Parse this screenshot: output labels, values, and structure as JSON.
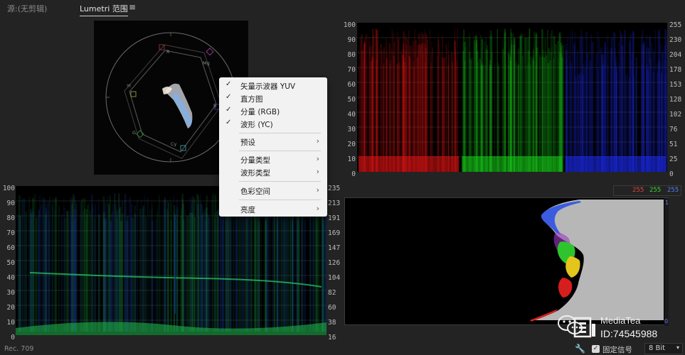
{
  "tabs": {
    "source": "源:(无剪辑)",
    "active": "Lumetri 范围",
    "menu_icon": "hamburger-menu-icon"
  },
  "vectorscope": {
    "targets": [
      "R",
      "Mg",
      "B",
      "Cy",
      "G",
      "Yl"
    ]
  },
  "parade": {
    "left_scale": [
      "100",
      "90",
      "80",
      "70",
      "60",
      "50",
      "40",
      "30",
      "20",
      "10",
      "0"
    ],
    "right_scale": [
      "255",
      "230",
      "204",
      "178",
      "153",
      "128",
      "102",
      "76",
      "51",
      "25",
      "0"
    ],
    "colors": {
      "red": "#e01414",
      "green": "#18d21a",
      "blue": "#1d2cf0"
    }
  },
  "waveform": {
    "left_scale": [
      "100",
      "90",
      "80",
      "70",
      "60",
      "50",
      "40",
      "30",
      "20",
      "10",
      "0"
    ],
    "right_scale": [
      "235",
      "213",
      "191",
      "169",
      "147",
      "126",
      "104",
      "82",
      "60",
      "38",
      "16"
    ],
    "colors": {
      "main": "#1a9c3c",
      "mix": "#1e40c8"
    }
  },
  "histogram": {
    "readout_r": "255",
    "readout_g": "255",
    "readout_b": "255",
    "scale_top": "1",
    "scale_bottom": "0",
    "colors": {
      "gray": "#b7b7b7",
      "blue": "#3b5be0",
      "green": "#2ec42e",
      "yellow": "#e3c51c",
      "red": "#d61e1e",
      "purple": "#9c3cc4"
    }
  },
  "context_menu": {
    "items": [
      {
        "label": "矢量示波器 YUV",
        "checked": true
      },
      {
        "label": "直方图",
        "checked": true
      },
      {
        "label": "分量 (RGB)",
        "checked": true
      },
      {
        "label": "波形 (YC)",
        "checked": true
      },
      {
        "label": "预设"
      },
      {
        "label": "分量类型"
      },
      {
        "label": "波形类型"
      },
      {
        "label": "色彩空间"
      },
      {
        "label": "亮度"
      }
    ],
    "check_glyph": "✓",
    "arrow_glyph": "›"
  },
  "status_bar": {
    "rec": "Rec. 709",
    "clamp_label": "固定信号",
    "bit_depth": "8 Bit",
    "checkbox_glyph": "✓",
    "dropdown_glyph": "▾",
    "wrench_icon": "wrench-icon"
  },
  "watermark": {
    "line1": "MediaTea",
    "line2": "ID:74545988"
  }
}
